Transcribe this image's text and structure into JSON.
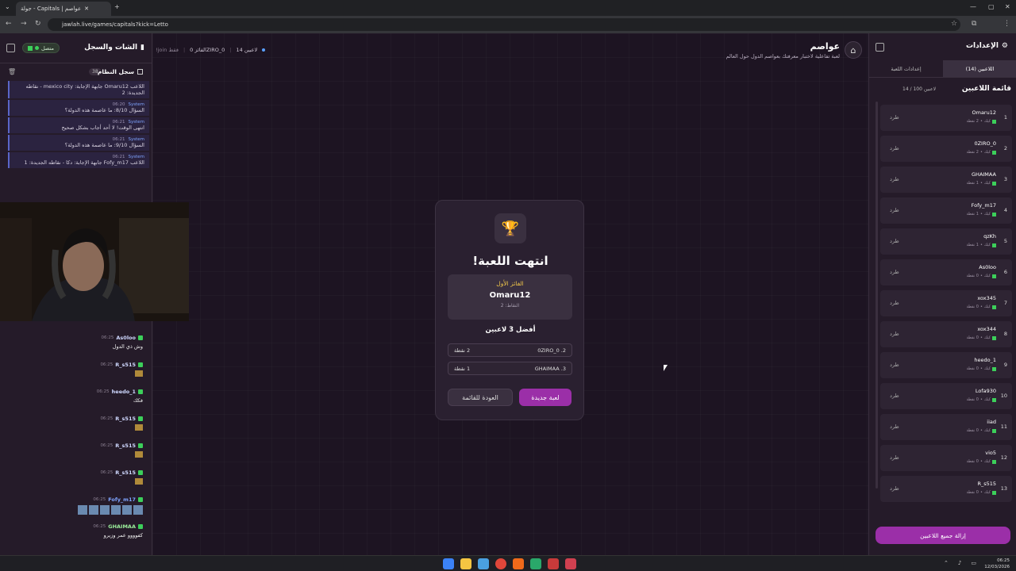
{
  "browser": {
    "tab_title": "عواصم | Capitals - جولة",
    "url": "jawlah.live/games/capitals?kick=Letto"
  },
  "header": {
    "title": "عواصم",
    "subtitle": "لعبة تفاعلية لاختبار معرفتك بعواصم الدول حول العالم",
    "players": "14 لاعبين",
    "winner": "الفائز 0ZIRO_0",
    "join_only": "!join فقط"
  },
  "chat": {
    "title": "الشات والسجل",
    "connection": "متصل",
    "syslog_title": "سجل النظام",
    "syslog_count": "38",
    "sys_messages": [
      {
        "time": "",
        "sender": "",
        "text": "اللاعب Omaru12 جابهة الإجابة: mexico city - نقاطه الجديدة: 2"
      },
      {
        "time": "06:20",
        "sender": "System",
        "text": "السؤال 8/10: ما عاصمة هذه الدولة؟"
      },
      {
        "time": "06:21",
        "sender": "System",
        "text": "انتهى الوقت! لا أحد أجاب بشكل صحيح"
      },
      {
        "time": "06:21",
        "sender": "System",
        "text": "السؤال 9/10: ما عاصمة هذه الدولة؟"
      },
      {
        "time": "06:21",
        "sender": "System",
        "text": "اللاعب Fofy_m17 جابهة الإجابة: دكا - نقاطه الجديدة: 1"
      }
    ],
    "messages": [
      {
        "time": "06:25",
        "name": "As0loo",
        "text": "وش ذي الدول"
      },
      {
        "time": "06:25",
        "name": "R_s515",
        "text": ""
      },
      {
        "time": "06:25",
        "name": "heedo_1",
        "text": "فكك"
      },
      {
        "time": "06:25",
        "name": "R_s515",
        "text": ""
      },
      {
        "time": "06:25",
        "name": "R_s515",
        "text": ""
      },
      {
        "time": "06:25",
        "name": "R_s515",
        "text": ""
      },
      {
        "time": "06:25",
        "name": "Fofy_m17",
        "text": ""
      },
      {
        "time": "06:25",
        "name": "GHAIMAA",
        "text": "كفوووو عمر وزيرو"
      }
    ]
  },
  "settings": {
    "title": "الإعدادات",
    "tab_players": "اللاعبين (14)",
    "tab_game": "إعدادات اللعبة",
    "list_title": "قائمة اللاعبين",
    "list_count": "14 / 100 لاعبين",
    "kick_label": "طرد",
    "remove_all": "إزالة جميع اللاعبين",
    "players": [
      {
        "rank": "1",
        "name": "Omaru12",
        "points": "2 نقطة"
      },
      {
        "rank": "2",
        "name": "0ZIRO_0",
        "points": "2 نقطة"
      },
      {
        "rank": "3",
        "name": "GHAIMAA",
        "points": "1 نقطة"
      },
      {
        "rank": "4",
        "name": "Fofy_m17",
        "points": "1 نقطة"
      },
      {
        "rank": "5",
        "name": "qzKh",
        "points": "1 نقطة"
      },
      {
        "rank": "6",
        "name": "As0loo",
        "points": "0 نقطة"
      },
      {
        "rank": "7",
        "name": "xox345",
        "points": "0 نقطة"
      },
      {
        "rank": "8",
        "name": "xox344",
        "points": "0 نقطة"
      },
      {
        "rank": "9",
        "name": "heedo_1",
        "points": "0 نقطة"
      },
      {
        "rank": "10",
        "name": "Lofa930",
        "points": "0 نقطة"
      },
      {
        "rank": "11",
        "name": "iiad",
        "points": "0 نقطة"
      },
      {
        "rank": "12",
        "name": "vio5",
        "points": "0 نقطة"
      },
      {
        "rank": "13",
        "name": "R_s515",
        "points": "0 نقطة"
      }
    ],
    "platform_label": "كيك"
  },
  "modal": {
    "title": "انتهت اللعبة!",
    "winner_label": "الفائز الأول",
    "winner_name": "Omaru12",
    "winner_points": "النقاط: 2",
    "top3_title": "أفضل 3 لاعبين",
    "top": [
      {
        "name": "0ZIRO_0 .2",
        "points": "2 نقطة"
      },
      {
        "name": "GHAIMAA .3",
        "points": "1 نقطة"
      }
    ],
    "new_game": "لعبة جديدة",
    "back": "العودة للقائمة"
  },
  "taskbar": {
    "time": "06:25",
    "date": "12/03/2026"
  }
}
